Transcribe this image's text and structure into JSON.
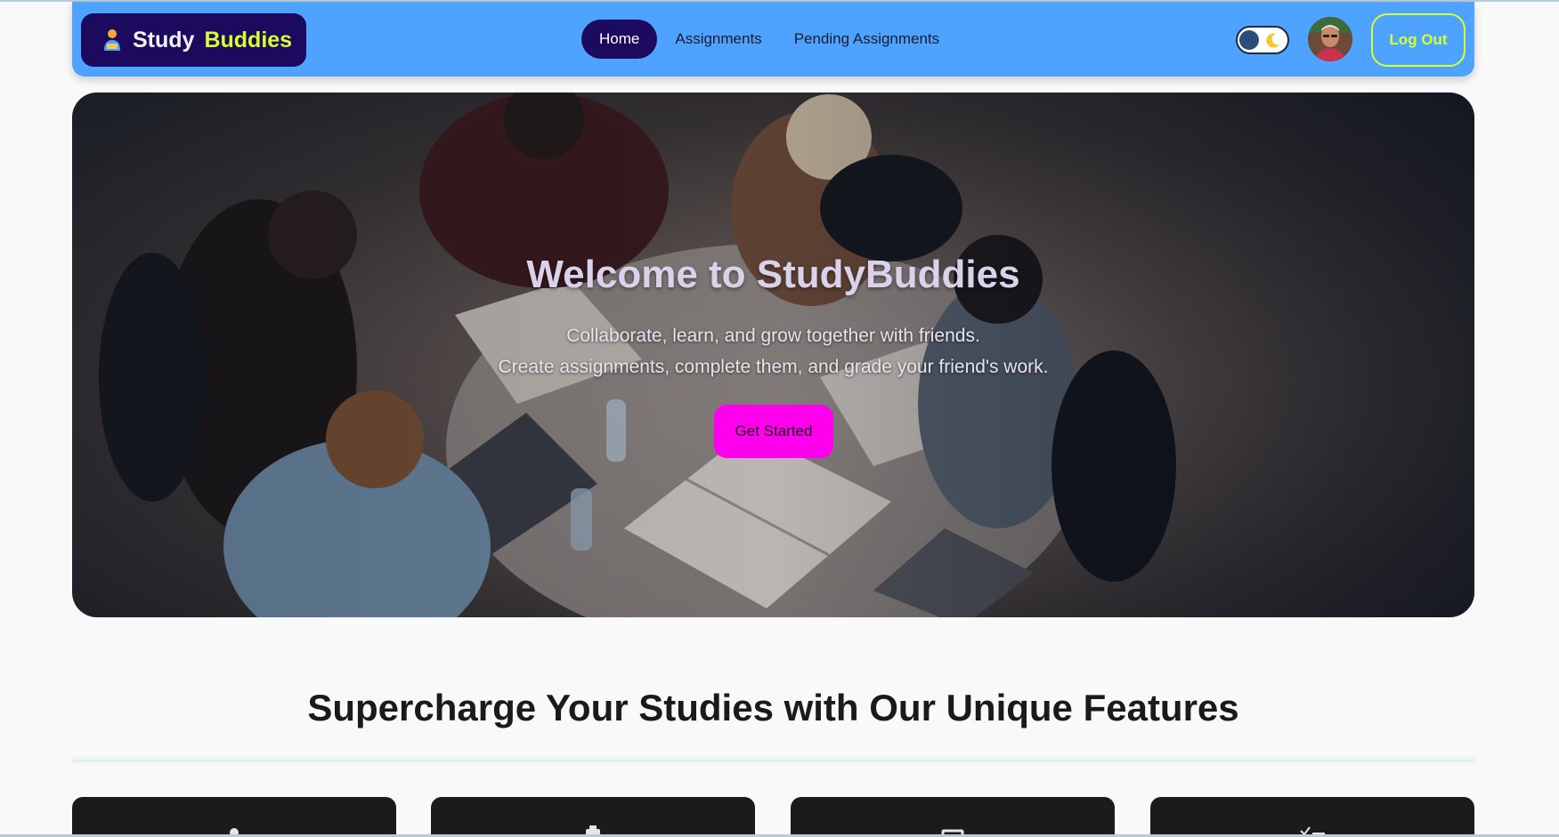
{
  "navbar": {
    "logo_part1": "Study",
    "logo_part2": "Buddies",
    "links": [
      {
        "label": "Home",
        "active": true
      },
      {
        "label": "Assignments",
        "active": false
      },
      {
        "label": "Pending Assignments",
        "active": false
      }
    ],
    "logout_label": "Log Out"
  },
  "hero": {
    "title": "Welcome to StudyBuddies",
    "subtitle_line1": "Collaborate, learn, and grow together with friends.",
    "subtitle_line2": "Create assignments, complete them, and grade your friend's work.",
    "cta_label": "Get Started"
  },
  "features": {
    "title": "Supercharge Your Studies with Our Unique Features",
    "cards": [
      {
        "icon": "person-icon"
      },
      {
        "icon": "clipboard-icon"
      },
      {
        "icon": "monitor-icon"
      },
      {
        "icon": "checklist-icon"
      }
    ]
  },
  "colors": {
    "navbar": "#4da3ff",
    "logo_bg": "#1c0a5e",
    "accent_lime": "#d6ff2e",
    "cta": "#ff00ee",
    "card_bg": "#1b1b1d"
  }
}
